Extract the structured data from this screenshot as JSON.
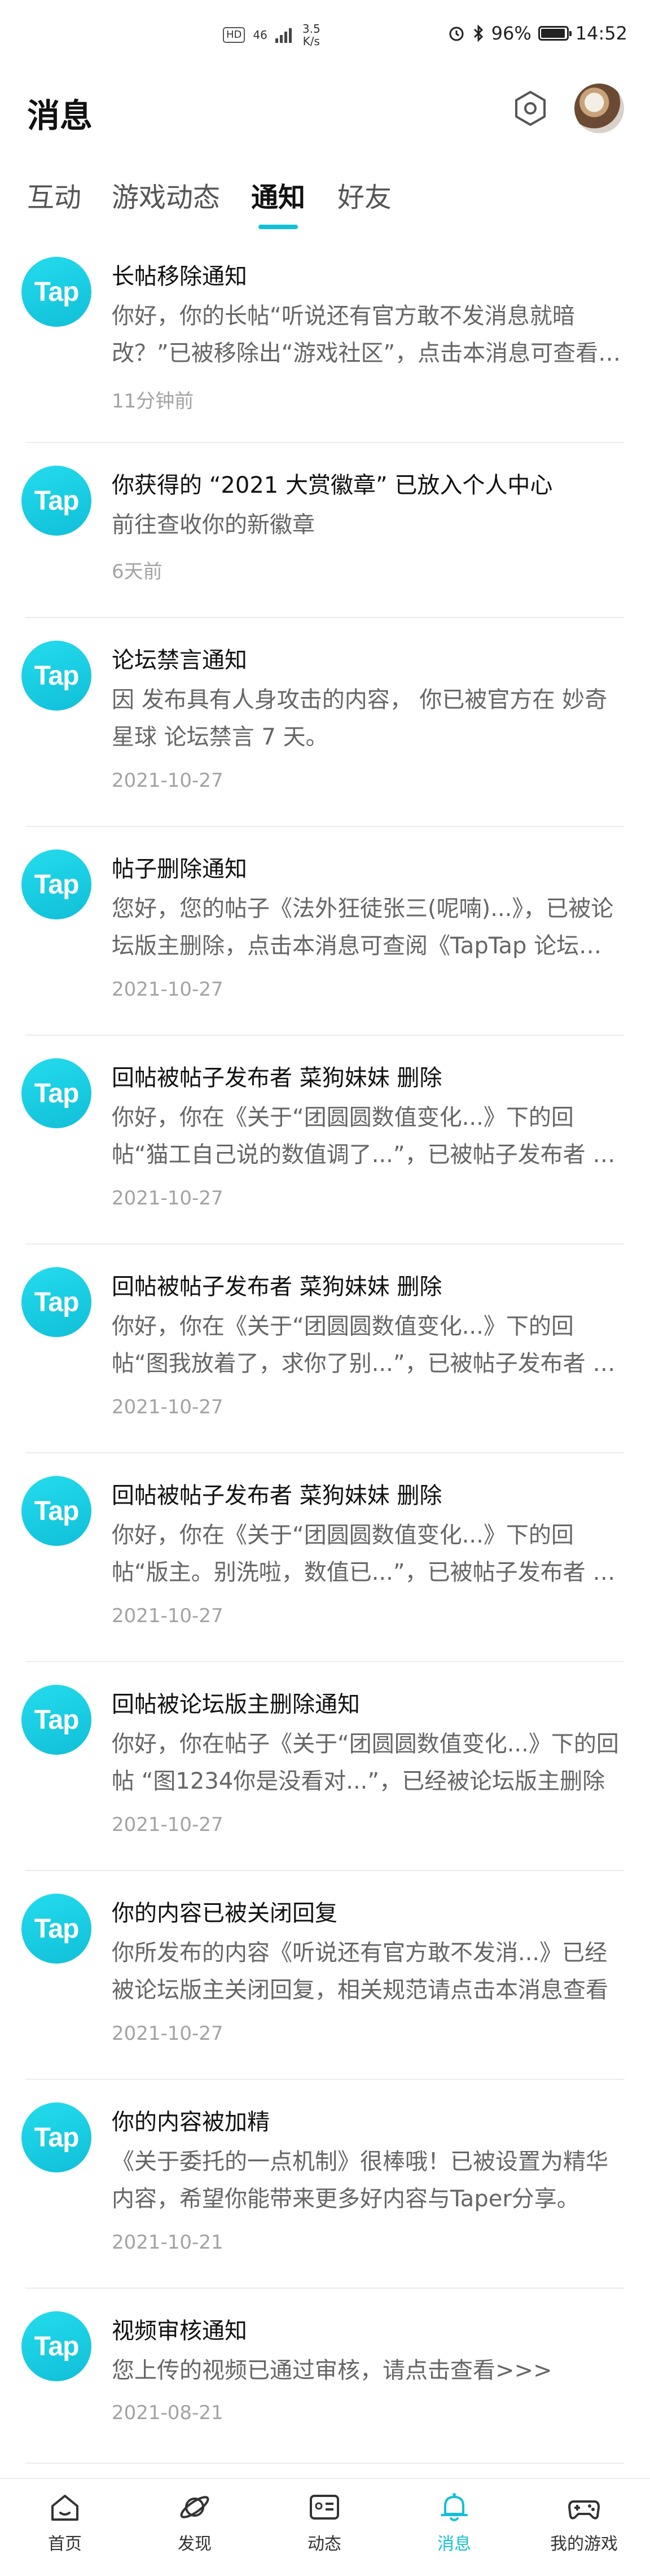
{
  "statusbar": {
    "network_badge": "HD",
    "signal_label": "46",
    "speed_value": "3.5",
    "speed_unit": "K/s",
    "battery_percent": "96%",
    "battery_level": 0.96,
    "time": "14:52"
  },
  "header": {
    "title": "消息",
    "settings_icon": "hexagon-gear-icon"
  },
  "tabs": [
    {
      "label": "互动"
    },
    {
      "label": "游戏动态"
    },
    {
      "label": "通知"
    },
    {
      "label": "好友"
    }
  ],
  "active_tab": "通知",
  "accent_color": "#14c0d6",
  "logo_text": "Tap",
  "notifications": [
    {
      "title": "长帖移除通知",
      "body": "你好，你的长帖“听说还有官方敢不发消息就暗改？”已被移除出“游戏社区”，点击本消息可查看详情",
      "time": "11分钟前"
    },
    {
      "title": "你获得的 “2021 大赏徽章” 已放入个人中心",
      "body": "前往查收你的新徽章",
      "time": "6天前"
    },
    {
      "title": "论坛禁言通知",
      "body": "因 发布具有人身攻击的内容， 你已被官方在 妙奇星球 论坛禁言 7 天。",
      "time": "2021-10-27"
    },
    {
      "title": "帖子删除通知",
      "body": "您好，您的帖子《法外狂徒张三(呢喃)...》，已被论坛版主删除，点击本消息可查阅《TapTap 论坛管理规范》",
      "time": "2021-10-27"
    },
    {
      "title": "回帖被帖子发布者 菜狗妹妹 删除",
      "body": "你好，你在《关于“团圆圆数值变化...》下的回帖“猫工自己说的数值调了...”，已被帖子发布者 菜狗妹妹 删除",
      "time": "2021-10-27"
    },
    {
      "title": "回帖被帖子发布者 菜狗妹妹 删除",
      "body": "你好，你在《关于“团圆圆数值变化...》下的回帖“图我放着了，求你了别...”，已被帖子发布者 菜狗妹妹 删除",
      "time": "2021-10-27"
    },
    {
      "title": "回帖被帖子发布者 菜狗妹妹 删除",
      "body": "你好，你在《关于“团圆圆数值变化...》下的回帖“版主。别洗啦，数值已...”，已被帖子发布者 菜狗妹妹 删除",
      "time": "2021-10-27"
    },
    {
      "title": "回帖被论坛版主删除通知",
      "body": "你好，你在帖子《关于“团圆圆数值变化...》下的回帖 “图1234你是没看对...”，已经被论坛版主删除",
      "time": "2021-10-27"
    },
    {
      "title": "你的内容已被关闭回复",
      "body": "你所发布的内容《听说还有官方敢不发消...》已经被论坛版主关闭回复，相关规范请点击本消息查看",
      "time": "2021-10-27"
    },
    {
      "title": "你的内容被加精",
      "body": "《关于委托的一点机制》很棒哦！已被设置为精华内容，希望你能带来更多好内容与Taper分享。",
      "time": "2021-10-21"
    },
    {
      "title": "视频审核通知",
      "body": "您上传的视频已通过审核，请点击查看>>>",
      "time": "2021-08-21"
    }
  ],
  "bottom_nav": [
    {
      "label": "首页",
      "icon": "home-icon"
    },
    {
      "label": "发现",
      "icon": "planet-icon"
    },
    {
      "label": "动态",
      "icon": "feed-icon"
    },
    {
      "label": "消息",
      "icon": "bell-icon"
    },
    {
      "label": "我的游戏",
      "icon": "gamepad-icon"
    }
  ]
}
